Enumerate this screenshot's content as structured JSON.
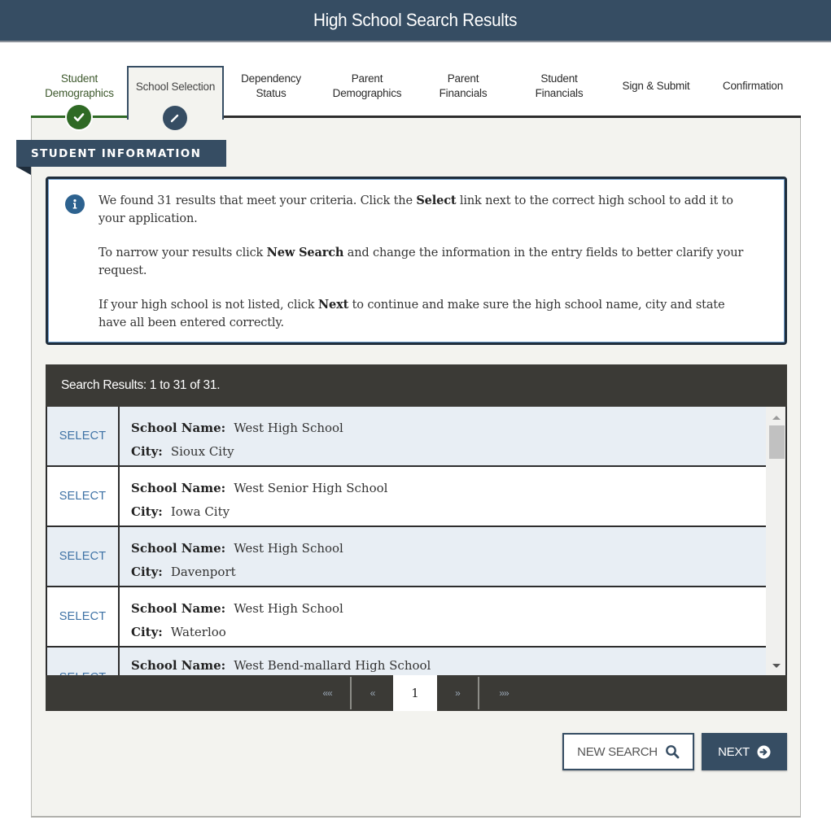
{
  "header": {
    "title": "High School Search Results"
  },
  "steps": [
    {
      "label": "Student Demographics",
      "line1": "Student",
      "line2": "Demographics",
      "status": "completed",
      "icon": "check-icon"
    },
    {
      "label": "School Selection",
      "line1": "School Selection",
      "line2": "",
      "status": "active",
      "icon": "pencil-icon"
    },
    {
      "label": "Dependency Status",
      "line1": "Dependency",
      "line2": "Status",
      "status": "pending"
    },
    {
      "label": "Parent Demographics",
      "line1": "Parent",
      "line2": "Demographics",
      "status": "pending"
    },
    {
      "label": "Parent Financials",
      "line1": "Parent",
      "line2": "Financials",
      "status": "pending"
    },
    {
      "label": "Student Financials",
      "line1": "Student",
      "line2": "Financials",
      "status": "pending"
    },
    {
      "label": "Sign & Submit",
      "line1": "Sign & Submit",
      "line2": "",
      "status": "pending"
    },
    {
      "label": "Confirmation",
      "line1": "Confirmation",
      "line2": "",
      "status": "pending"
    }
  ],
  "section": {
    "title": "STUDENT INFORMATION"
  },
  "info": {
    "p1_a": "We found 31 results that meet your criteria. Click the ",
    "p1_b": "Select",
    "p1_c": " link next to the correct high school to add it to your application.",
    "p2_a": "To narrow your results click ",
    "p2_b": "New Search",
    "p2_c": " and change the information in the entry fields to better clarify your request.",
    "p3_a": "If your high school is not listed, click ",
    "p3_b": "Next",
    "p3_c": " to continue and make sure the high school name, city and state have all been entered correctly."
  },
  "results": {
    "summary": "Search Results: 1 to 31 of 31.",
    "select_label": "SELECT",
    "school_label": "School Name:",
    "city_label": "City:",
    "rows": [
      {
        "school": "West High School",
        "city": "Sioux City"
      },
      {
        "school": "West Senior High School",
        "city": "Iowa City"
      },
      {
        "school": "West High School",
        "city": "Davenport"
      },
      {
        "school": "West High School",
        "city": "Waterloo"
      },
      {
        "school": "West Bend-mallard High School",
        "city": ""
      }
    ]
  },
  "pagination": {
    "first": "««",
    "prev": "«",
    "current": "1",
    "next": "»",
    "last": "»»"
  },
  "buttons": {
    "new_search": "NEW SEARCH",
    "next": "NEXT"
  },
  "colors": {
    "primary": "#364d63",
    "success": "#2f6a25",
    "link": "#3e72a5",
    "dark": "#3b3a36"
  }
}
